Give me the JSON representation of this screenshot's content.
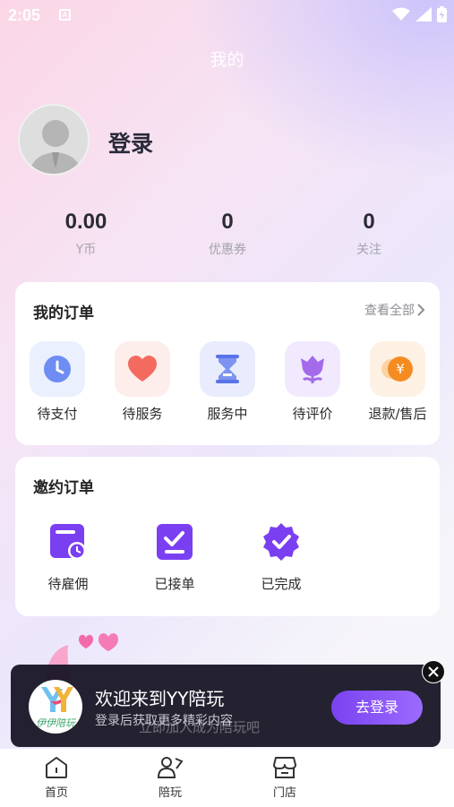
{
  "status_bar": {
    "time": "2:05",
    "notification_icon": "A"
  },
  "page_title": "我的",
  "profile": {
    "login_label": "登录"
  },
  "stats": [
    {
      "value": "0.00",
      "label": "Y币"
    },
    {
      "value": "0",
      "label": "优惠券"
    },
    {
      "value": "0",
      "label": "关注"
    }
  ],
  "my_orders": {
    "title": "我的订单",
    "see_all": "查看全部",
    "items": [
      {
        "label": "待支付",
        "icon": "clock-icon"
      },
      {
        "label": "待服务",
        "icon": "heart-icon"
      },
      {
        "label": "服务中",
        "icon": "hourglass-icon"
      },
      {
        "label": "待评价",
        "icon": "flower-icon"
      },
      {
        "label": "退款/售后",
        "icon": "refund-icon"
      }
    ]
  },
  "invite_orders": {
    "title": "邀约订单",
    "items": [
      {
        "label": "待雇佣",
        "icon": "calendar-clock-icon"
      },
      {
        "label": "已接单",
        "icon": "check-square-icon"
      },
      {
        "label": "已完成",
        "icon": "badge-check-icon"
      }
    ]
  },
  "banner": {
    "title": "欢迎来到YY陪玩",
    "subtitle": "登录后获取更多精彩内容",
    "button": "去登录",
    "logo_text": "伊伊陪玩",
    "background_text": "立即加入成为陪玩吧"
  },
  "tabs": [
    {
      "label": "首页",
      "icon": "home-icon"
    },
    {
      "label": "陪玩",
      "icon": "companion-icon"
    },
    {
      "label": "门店",
      "icon": "store-icon"
    }
  ],
  "colors": {
    "accent": "#7a42f0",
    "invite_icon": "#7b3ff2"
  }
}
